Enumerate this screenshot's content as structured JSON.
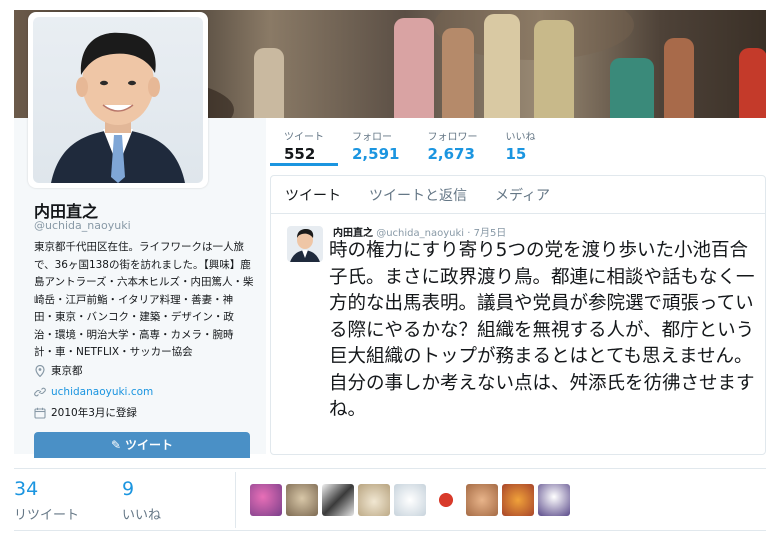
{
  "profile": {
    "name": "内田直之",
    "handle": "@uchida_naoyuki",
    "bio": "東京都千代田区在住。ライフワークは一人旅で、36ヶ国138の街を訪れました。【興味】鹿島アントラーズ・六本木ヒルズ・内田篤人・柴崎岳・江戸前鮨・イタリア料理・善妻・神田・東京・バンコク・建築・デザイン・政治・環境・明治大学・高専・カメラ・腕時計・車・NETFLIX・サッカー協会",
    "location": "東京都",
    "url": "uchidanaoyuki.com",
    "joined": "2010年3月に登録",
    "tweet_button": "ツイート"
  },
  "stats": [
    {
      "label": "ツイート",
      "value": "552"
    },
    {
      "label": "フォロー",
      "value": "2,591"
    },
    {
      "label": "フォロワー",
      "value": "2,673"
    },
    {
      "label": "いいね",
      "value": "15"
    }
  ],
  "tabs": [
    "ツイート",
    "ツイートと返信",
    "メディア"
  ],
  "tweet": {
    "author": "内田直之",
    "handle": "@uchida_naoyuki",
    "date": "· 7月5日",
    "text": "時の権力にすり寄り5つの党を渡り歩いた小池百合子氏。まさに政界渡り鳥。都連に相談や話もなく一方的な出馬表明。議員や党員が参院選で頑張っている際にやるかな？組織を無視する人が、都庁という巨大組織のトップが務まるとはとても思えません。自分の事しか考えない点は、舛添氏を彷彿させますね。"
  },
  "engagement": {
    "retweets": {
      "value": "34",
      "label": "リツイート"
    },
    "likes": {
      "value": "9",
      "label": "いいね"
    }
  },
  "icons": {
    "location": "location-pin-icon",
    "link": "link-icon",
    "calendar": "calendar-icon",
    "compose": "compose-icon"
  },
  "colors": {
    "accent": "#1b95e0",
    "button": "#4a90c6",
    "panel": "#f5f8fa"
  }
}
